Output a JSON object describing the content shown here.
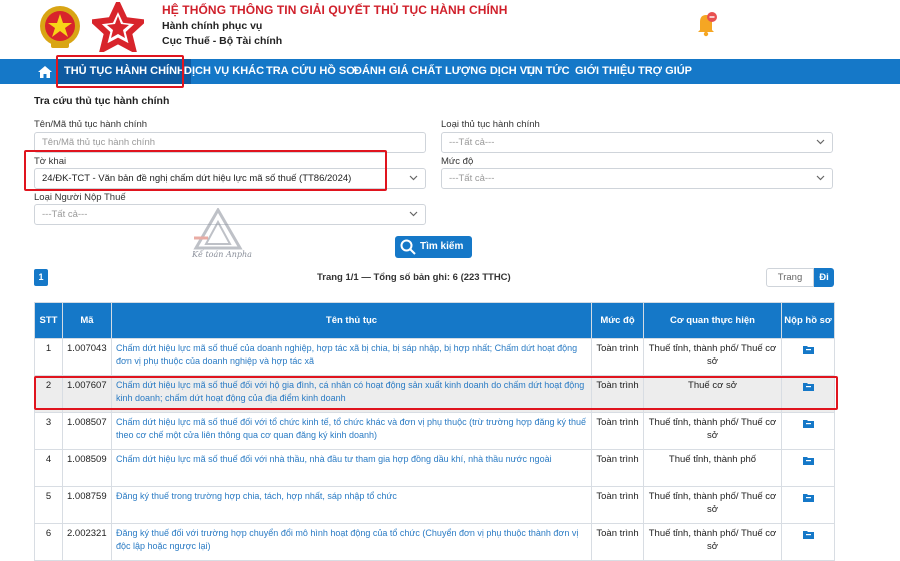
{
  "header": {
    "title": "HỆ THỐNG THÔNG TIN GIẢI QUYẾT THỦ TỤC HÀNH CHÍNH",
    "subtitle1": "Hành chính phục vụ",
    "subtitle2": "Cục Thuế - Bộ Tài chính"
  },
  "nav": {
    "items": [
      "THỦ TỤC HÀNH CHÍNH",
      "DỊCH VỤ KHÁC",
      "TRA CỨU HỒ SƠ",
      "ĐÁNH GIÁ CHẤT LƯỢNG DỊCH VỤ",
      "TIN TỨC",
      "GIỚI THIỆU",
      "TRỢ GIÚP"
    ],
    "active": "THỦ TỤC HÀNH CHÍNH"
  },
  "search": {
    "section_title": "Tra cứu thủ tục hành chính",
    "name_label": "Tên/Mã thủ tục hành chính",
    "name_placeholder": "Tên/Mã thủ tục hành chính",
    "type_label": "Loại thủ tục hành chính",
    "type_value": "---Tất cả---",
    "form_label": "Tờ khai",
    "form_value": "24/ĐK-TCT - Văn bản đề nghị chấm dứt hiệu lực mã số thuế (TT86/2024)",
    "level_label": "Mức độ",
    "level_value": "---Tất cả---",
    "taxpayer_label": "Loại Người Nộp Thuế",
    "taxpayer_value": "---Tất cả---",
    "search_button": "Tìm kiếm"
  },
  "watermark": {
    "text": "Kế toán Anpha"
  },
  "pagination": {
    "current_page": "1",
    "summary": "Trang 1/1 — Tổng số bản ghi: 6 (223 TTHC)",
    "page_input_placeholder": "Trang",
    "go_button": "Đi"
  },
  "table": {
    "headers": [
      "STT",
      "Mã",
      "Tên thủ tục",
      "Mức độ",
      "Cơ quan thực hiện",
      "Nộp hồ sơ"
    ],
    "rows": [
      {
        "stt": "1",
        "code": "1.007043",
        "name": "Chấm dứt hiệu lực mã số thuế của doanh nghiệp, hợp tác xã bị chia, bị sáp nhập, bị hợp nhất; Chấm dứt hoạt động đơn vị phụ thuộc của doanh nghiệp và hợp tác xã",
        "level": "Toàn trình",
        "agency": "Thuế tỉnh, thành phố/ Thuế cơ sở"
      },
      {
        "stt": "2",
        "code": "1.007607",
        "name": "Chấm dứt hiệu lực mã số thuế đối với hộ gia đình, cá nhân có hoạt động sản xuất kinh doanh do chấm dứt hoạt động kinh doanh; chấm dứt hoạt động của địa điểm kinh doanh",
        "level": "Toàn trình",
        "agency": "Thuế cơ sở"
      },
      {
        "stt": "3",
        "code": "1.008507",
        "name": "Chấm dứt hiệu lực mã số thuế đối với tổ chức kinh tế, tổ chức khác và đơn vị phụ thuộc (trừ trường hợp đăng ký thuế theo cơ chế một cửa liên thông qua cơ quan đăng ký kinh doanh)",
        "level": "Toàn trình",
        "agency": "Thuế tỉnh, thành phố/ Thuế cơ sở"
      },
      {
        "stt": "4",
        "code": "1.008509",
        "name": "Chấm dứt hiệu lực mã số thuế đối với nhà thầu, nhà đầu tư tham gia hợp đồng dầu khí, nhà thầu nước ngoài",
        "level": "Toàn trình",
        "agency": "Thuế tỉnh, thành phố"
      },
      {
        "stt": "5",
        "code": "1.008759",
        "name": "Đăng ký thuế trong trường hợp chia, tách, hợp nhất, sáp nhập tổ chức",
        "level": "Toàn trình",
        "agency": "Thuế tỉnh, thành phố/ Thuế cơ sở"
      },
      {
        "stt": "6",
        "code": "2.002321",
        "name": "Đăng ký thuế đối với trường hợp chuyển đổi mô hình hoạt động của tổ chức (Chuyển đơn vị phụ thuộc thành đơn vị độc lập hoặc ngược lại)",
        "level": "Toàn trình",
        "agency": "Thuế tỉnh, thành phố/ Thuế cơ sở"
      }
    ]
  },
  "colors": {
    "primary": "#1578c8",
    "title_red": "#d0202b",
    "highlight_red": "#e0141e",
    "link": "#2a7bc4"
  }
}
